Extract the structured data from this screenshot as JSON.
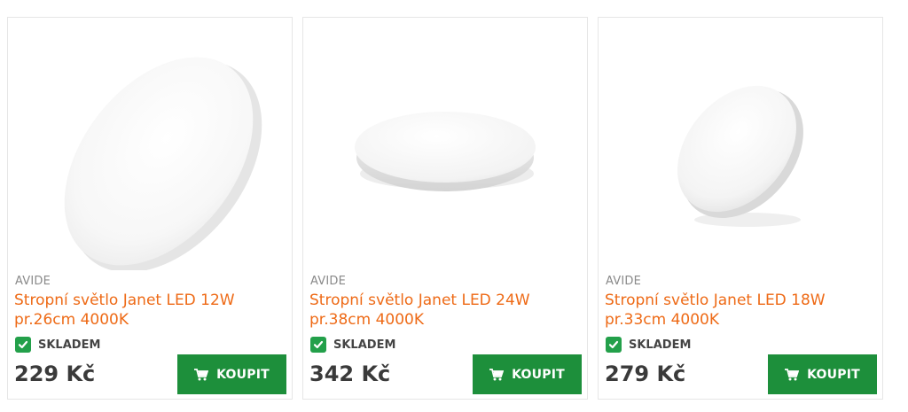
{
  "products": [
    {
      "brand": "AVIDE",
      "title": "Stropní světlo Janet LED 12W pr.26cm 4000K",
      "stock": "SKLADEM",
      "price": "229 Kč",
      "buy_label": "KOUPIT",
      "image_icon": "ceiling-light-image"
    },
    {
      "brand": "AVIDE",
      "title": "Stropní světlo Janet LED 24W pr.38cm 4000K",
      "stock": "SKLADEM",
      "price": "342 Kč",
      "buy_label": "KOUPIT",
      "image_icon": "ceiling-light-image"
    },
    {
      "brand": "AVIDE",
      "title": "Stropní světlo Janet LED 18W pr.33cm 4000K",
      "stock": "SKLADEM",
      "price": "279 Kč",
      "buy_label": "KOUPIT",
      "image_icon": "ceiling-light-image"
    }
  ],
  "colors": {
    "title": "#ee6a16",
    "button": "#1d8f3b",
    "stock_check": "#23a04a",
    "price": "#3a3a3a",
    "brand": "#8a8a8a"
  }
}
